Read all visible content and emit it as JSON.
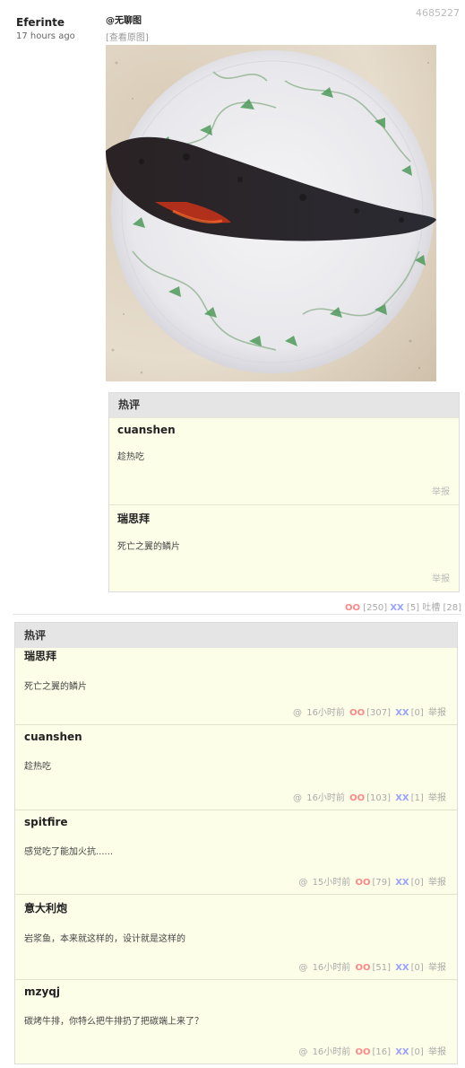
{
  "post": {
    "id": "4685227",
    "author": "Eferinte",
    "time": "17 hours ago",
    "tag": "@无聊图",
    "view_original": "[查看原图]",
    "votes": {
      "oo_label": "OO",
      "oo_count": "[250]",
      "xx_label": "XX",
      "xx_count": "[5]",
      "comment_label": "吐槽",
      "comment_count": "[28]"
    }
  },
  "post_hot": {
    "title": "热评",
    "items": [
      {
        "user": "cuanshen",
        "text": "趁热吃",
        "report": "举报"
      },
      {
        "user": "瑞思拜",
        "text": "死亡之翼的鳞片",
        "report": "举报"
      }
    ]
  },
  "comments": {
    "title": "热评",
    "items": [
      {
        "user": "瑞思拜",
        "text": "死亡之翼的鳞片",
        "at": "@",
        "time": "16小时前",
        "oo": "OO",
        "oo_count": "[307]",
        "xx": "XX",
        "xx_count": "[0]",
        "report": "举报"
      },
      {
        "user": "cuanshen",
        "text": "趁热吃",
        "at": "@",
        "time": "16小时前",
        "oo": "OO",
        "oo_count": "[103]",
        "xx": "XX",
        "xx_count": "[1]",
        "report": "举报"
      },
      {
        "user": "spitfire",
        "text": "感觉吃了能加火抗......",
        "at": "@",
        "time": "15小时前",
        "oo": "OO",
        "oo_count": "[79]",
        "xx": "XX",
        "xx_count": "[0]",
        "report": "举报"
      },
      {
        "user": "意大利炮",
        "text": "岩浆鱼，本来就这样的，设计就是这样的",
        "at": "@",
        "time": "16小时前",
        "oo": "OO",
        "oo_count": "[51]",
        "xx": "XX",
        "xx_count": "[0]",
        "report": "举报"
      },
      {
        "user": "mzyqj",
        "text": "碳烤牛排，你特么把牛排扔了把碳端上来了？",
        "at": "@",
        "time": "16小时前",
        "oo": "OO",
        "oo_count": "[16]",
        "xx": "XX",
        "xx_count": "[0]",
        "report": "举报"
      }
    ]
  }
}
